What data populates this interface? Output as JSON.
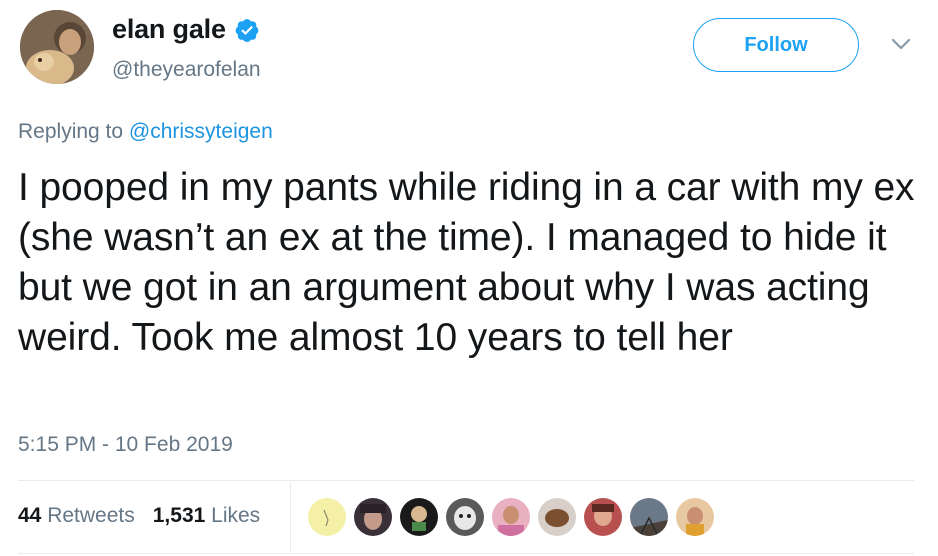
{
  "user": {
    "display_name": "elan gale",
    "handle": "@theyearofelan",
    "verified_icon": "verified-badge-icon"
  },
  "follow_label": "Follow",
  "menu_icon": "chevron-down-icon",
  "reply": {
    "prefix": "Replying to ",
    "mention": "@chrissyteigen"
  },
  "tweet_text": "I pooped in my pants while riding in a car with my ex (she wasn’t an ex at the time). I managed to hide it but we got in an argument about why I was acting weird. Took me almost 10 years to tell her",
  "timestamp": "5:15 PM - 10 Feb 2019",
  "stats": {
    "retweets_count": "44",
    "retweets_label": "Retweets",
    "likes_count": "1,531",
    "likes_label": "Likes"
  },
  "colors": {
    "accent": "#1da1f2",
    "text": "#14171a",
    "muted": "#657786"
  }
}
